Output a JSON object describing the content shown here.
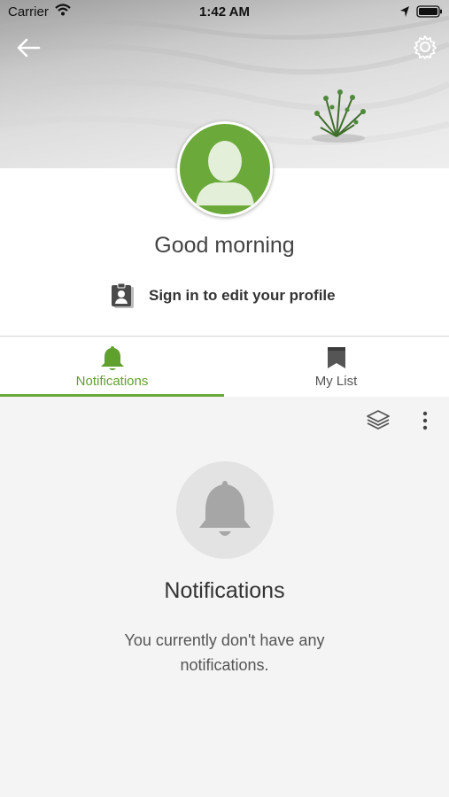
{
  "status_bar": {
    "carrier": "Carrier",
    "time": "1:42 AM"
  },
  "header": {
    "background": "sand-with-plant-photo"
  },
  "profile": {
    "greeting": "Good morning",
    "sign_in_label": "Sign in to edit your profile",
    "avatar_color": "#6aa93a"
  },
  "tabs": [
    {
      "label": "Notifications",
      "icon": "bell-icon",
      "active": true
    },
    {
      "label": "My List",
      "icon": "bookmark-icon",
      "active": false
    }
  ],
  "accent_color": "#6aa93a",
  "empty_state": {
    "title": "Notifications",
    "message": "You currently don't have any notifications."
  }
}
